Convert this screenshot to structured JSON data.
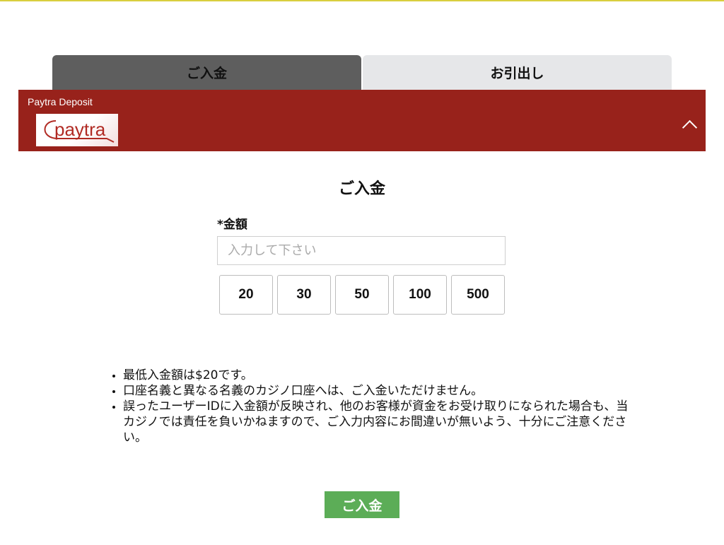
{
  "tabs": [
    {
      "label": "ご入金",
      "active": true
    },
    {
      "label": "お引出し",
      "active": false
    }
  ],
  "method": {
    "title": "Paytra Deposit",
    "logo_text": "paytra",
    "icon": "chevron-up-icon"
  },
  "deposit": {
    "section_title": "ご入金",
    "amount_label": "*金額",
    "amount_placeholder": "入力して下さい",
    "amount_value": "",
    "presets": [
      "20",
      "30",
      "50",
      "100",
      "500"
    ]
  },
  "notes": [
    "最低入金額は$20です。",
    "口座名義と異なる名義のカジノ口座へは、ご入金いただけません。",
    "誤ったユーザーIDに入金額が反映され、他のお客様が資金をお受け取りになられた場合も、当カジノでは責任を負いかねますので、ご入力内容にお間違いが無いよう、十分にご注意ください。"
  ],
  "submit_label": "ご入金",
  "colors": {
    "accent_bar": "#98221b",
    "active_tab": "#5e5e5e",
    "inactive_tab": "#e6e7e9",
    "submit": "#5cad57"
  }
}
